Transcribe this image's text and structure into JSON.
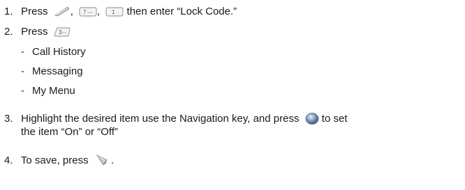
{
  "steps": [
    {
      "number": "1.",
      "prefix": "Press",
      "sep1": ",",
      "sep2": ",",
      "suffix": "then enter “Lock Code.”",
      "keys": [
        "menu-soft-key-icon",
        "key-7-icon",
        "key-1-icon"
      ]
    },
    {
      "number": "2.",
      "prefix": "Press",
      "keys": [
        "key-3-icon"
      ]
    },
    {
      "number": "3.",
      "line1_prefix": "Highlight the desired item use the Navigation key, and press",
      "line1_suffix": "to set",
      "line2": "the item “On” or “Off”",
      "keys": [
        "ok-key-icon"
      ]
    },
    {
      "number": "4.",
      "prefix": "To save, press",
      "suffix": ".",
      "keys": [
        "left-soft-key-icon"
      ]
    }
  ],
  "sub_items": [
    {
      "bullet": "-",
      "label": "Call History"
    },
    {
      "bullet": "-",
      "label": "Messaging"
    },
    {
      "bullet": "-",
      "label": "My Menu"
    }
  ]
}
